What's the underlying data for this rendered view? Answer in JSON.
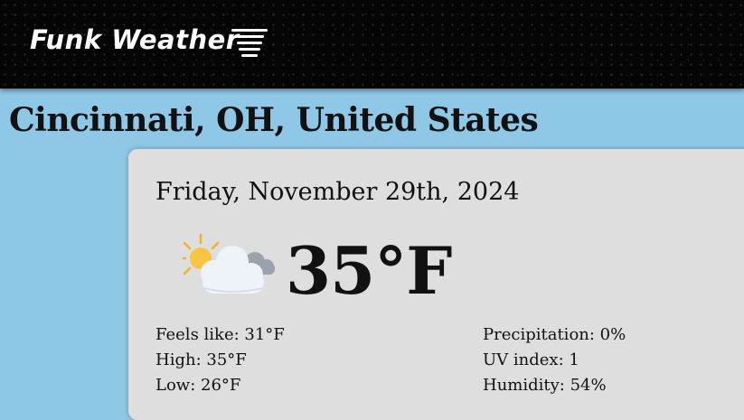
{
  "header": {
    "brand": "Funk Weather",
    "menu_icon": "menu-icon"
  },
  "location": {
    "title": "Cincinnati, OH, United States"
  },
  "current": {
    "date": "Friday, November 29th, 2024",
    "condition_icon": "partly-cloudy-icon",
    "temperature": "35°F",
    "left_stats": [
      {
        "label": "Feels like:",
        "value": "31°F"
      },
      {
        "label": "High:",
        "value": "35°F"
      },
      {
        "label": "Low:",
        "value": "26°F"
      }
    ],
    "right_stats": [
      {
        "label": "Precipitation:",
        "value": "0%"
      },
      {
        "label": "UV index:",
        "value": "1"
      },
      {
        "label": "Humidity:",
        "value": "54%"
      }
    ]
  },
  "colors": {
    "page_background": "#8fc7e6",
    "header_background": "#050505",
    "card_background": "#dedede"
  }
}
